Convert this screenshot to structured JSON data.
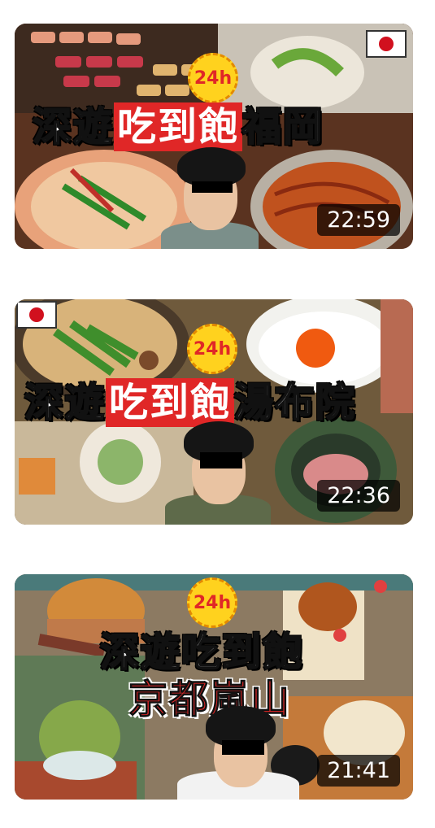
{
  "videos": [
    {
      "title_white_1": "深遊",
      "title_red": "吃到飽",
      "title_white_2": "福岡",
      "badge": "24h",
      "duration": "22:59"
    },
    {
      "title_white_1": "深遊",
      "title_red": "吃到飽",
      "title_white_2": "湯布院",
      "badge": "24h",
      "duration": "22:36"
    },
    {
      "title_line1": "深遊吃到飽",
      "title_line2": "京都嵐山",
      "badge": "24h",
      "duration": "21:41"
    }
  ],
  "colors": {
    "accent_red": "#e02727",
    "badge_yellow": "#ffd21e"
  },
  "icons": [
    "japan-flag-icon"
  ]
}
